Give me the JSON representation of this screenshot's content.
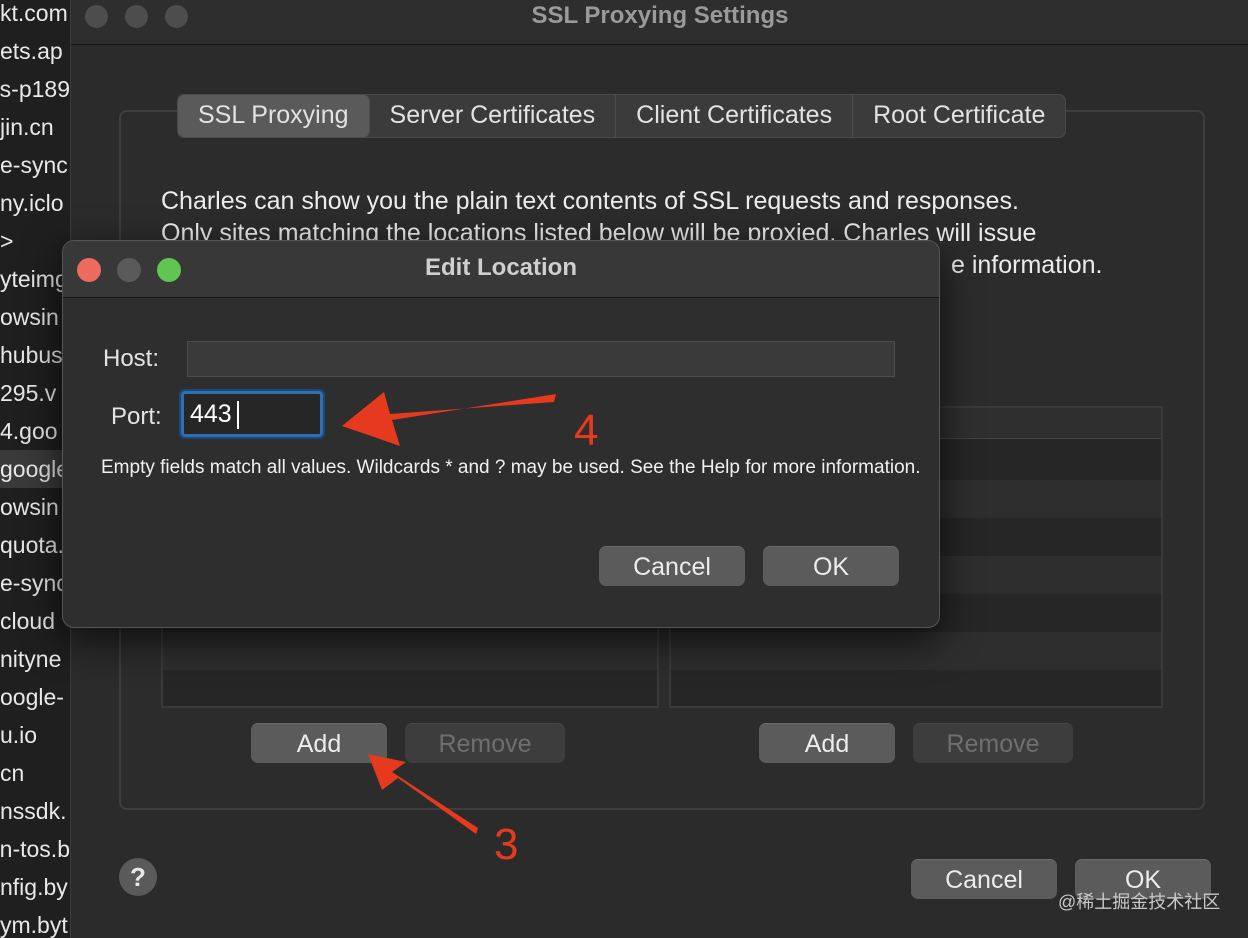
{
  "host_list": [
    {
      "text": "kt.com"
    },
    {
      "text": "ets.ap"
    },
    {
      "text": "s-p189"
    },
    {
      "text": "jin.cn"
    },
    {
      "text": "e-sync"
    },
    {
      "text": "ny.iclo"
    },
    {
      "text": ">"
    },
    {
      "text": "yteimg"
    },
    {
      "text": "owsin"
    },
    {
      "text": "hubus"
    },
    {
      "text": "295.v"
    },
    {
      "text": "4.goo"
    },
    {
      "text": "google",
      "selected": true
    },
    {
      "text": "owsin"
    },
    {
      "text": "quota."
    },
    {
      "text": "e-sync"
    },
    {
      "text": "cloud"
    },
    {
      "text": "nityne"
    },
    {
      "text": "oogle-"
    },
    {
      "text": "u.io"
    },
    {
      "text": "cn"
    },
    {
      "text": "nssdk."
    },
    {
      "text": "n-tos.b"
    },
    {
      "text": "nfig.by"
    },
    {
      "text": "ym.byt"
    }
  ],
  "main_window": {
    "title": "SSL Proxying Settings",
    "tabs": [
      {
        "label": "SSL Proxying",
        "active": true
      },
      {
        "label": "Server Certificates"
      },
      {
        "label": "Client Certificates"
      },
      {
        "label": "Root Certificate"
      }
    ],
    "description_line1": "Charles can show you the plain text contents of SSL requests and responses.",
    "description_line2": "Only sites matching the locations listed below will be proxied. Charles will issue",
    "description_line3": "e information.",
    "include_add": "Add",
    "include_remove": "Remove",
    "exclude_add": "Add",
    "exclude_remove": "Remove",
    "cancel": "Cancel",
    "ok": "OK",
    "help": "?"
  },
  "dialog": {
    "title": "Edit Location",
    "host_label": "Host:",
    "host_value": "",
    "port_label": "Port:",
    "port_value": "443",
    "hint": "Empty fields match all values. Wildcards * and ? may be used. See the Help for more information.",
    "cancel": "Cancel",
    "ok": "OK"
  },
  "annotations": {
    "step3": "3",
    "step4": "4",
    "color": "#e53a1e"
  },
  "watermark": "@稀土掘金技术社区",
  "colors": {
    "close": "#ed6a5e",
    "minimize": "#5a5a5a",
    "zoom": "#61c554",
    "focus": "#2d6fb0"
  }
}
